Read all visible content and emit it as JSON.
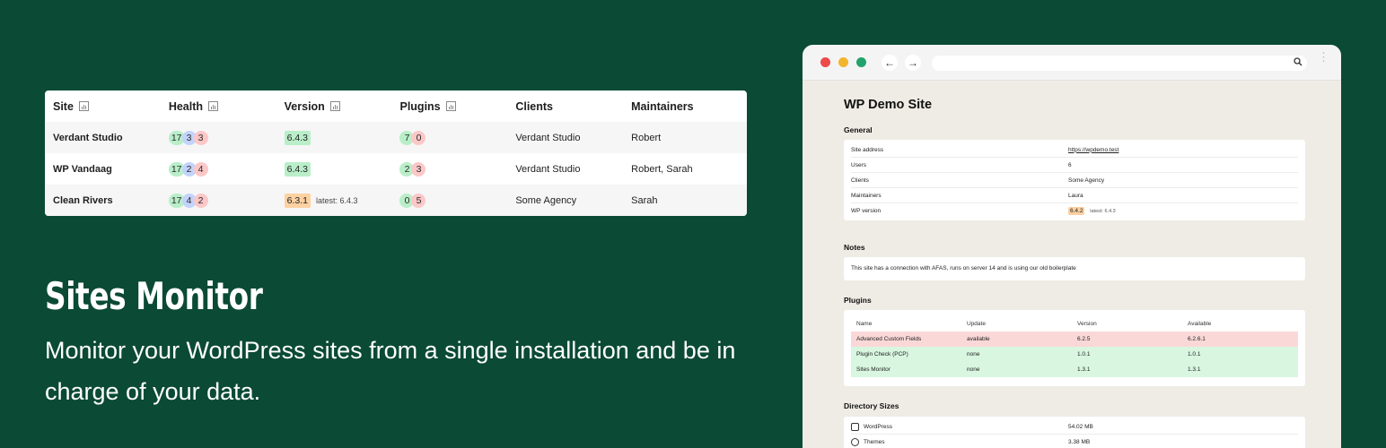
{
  "sites_table": {
    "headers": [
      "Site",
      "Health",
      "Version",
      "Plugins",
      "Clients",
      "Maintainers"
    ],
    "rows": [
      {
        "site": "Verdant Studio",
        "health": [
          "17",
          "3",
          "3"
        ],
        "version": "6.4.3",
        "version_status": "ok",
        "latest": "",
        "plugins": [
          "7",
          "0"
        ],
        "clients": "Verdant Studio",
        "maintainers": "Robert"
      },
      {
        "site": "WP Vandaag",
        "health": [
          "17",
          "2",
          "4"
        ],
        "version": "6.4.3",
        "version_status": "ok",
        "latest": "",
        "plugins": [
          "2",
          "3"
        ],
        "clients": "Verdant Studio",
        "maintainers": "Robert, Sarah"
      },
      {
        "site": "Clean Rivers",
        "health": [
          "17",
          "4",
          "2"
        ],
        "version": "6.3.1",
        "version_status": "old",
        "latest": "latest: 6.4.3",
        "plugins": [
          "0",
          "5"
        ],
        "clients": "Some Agency",
        "maintainers": "Sarah"
      }
    ]
  },
  "hero": {
    "title": "Sites Monitor",
    "tagline": "Monitor your WordPress sites from a single installation and be in charge of your data."
  },
  "browser": {
    "back_icon": "←",
    "forward_icon": "→",
    "search_icon": "🔍",
    "menu_icon": "⋮"
  },
  "demo": {
    "title": "WP Demo Site",
    "general_title": "General",
    "general": [
      {
        "key": "Site address",
        "value": "https://wpdemo.test",
        "link": true
      },
      {
        "key": "Users",
        "value": "6"
      },
      {
        "key": "Clients",
        "value": "Some Agency"
      },
      {
        "key": "Maintainers",
        "value": "Laura"
      },
      {
        "key": "WP version",
        "value": "6.4.2",
        "latest": "latest: 6.4.3"
      }
    ],
    "notes_title": "Notes",
    "notes": "This site has a connection with AFAS, runs on server 14 and is using our old boilerplate",
    "plugins_title": "Plugins",
    "plugins_headers": [
      "Name",
      "Update",
      "Version",
      "Available"
    ],
    "plugins": [
      {
        "name": "Advanced Custom Fields",
        "update": "available",
        "version": "6.2.5",
        "available": "6.2.6.1",
        "status": "red"
      },
      {
        "name": "Plugin Check (PCP)",
        "update": "none",
        "version": "1.0.1",
        "available": "1.0.1",
        "status": "green"
      },
      {
        "name": "Sites Monitor",
        "update": "none",
        "version": "1.3.1",
        "available": "1.3.1",
        "status": "green"
      }
    ],
    "dirs_title": "Directory Sizes",
    "dirs": [
      {
        "name": "WordPress",
        "size": "54.02 MB",
        "icon": "wordpress-icon"
      },
      {
        "name": "Themes",
        "size": "3.38 MB",
        "icon": "themes-icon"
      }
    ]
  },
  "colors": {
    "background": "#0b4a35",
    "health_good": "#b9eec9",
    "health_recommended": "#c3d3fb",
    "health_critical": "#fcc7c7",
    "version_outdated": "#fdd1a1"
  }
}
